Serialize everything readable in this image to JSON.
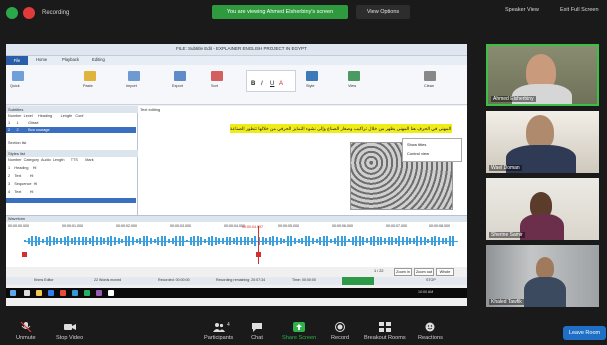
{
  "zoom": {
    "recording_label": "Recording",
    "banner": "You are viewing Ahmed Elsherbiny's screen",
    "view_options": "View Options",
    "speaker_view": "Speaker View",
    "exit_fullscreen": "Exit Full Screen",
    "participants_count": "4",
    "leave": "Leave Room"
  },
  "toolbar": [
    {
      "label": "Unmute",
      "icon": "microphone-muted-icon"
    },
    {
      "label": "Stop Video",
      "icon": "video-camera-icon"
    },
    {
      "label": "Participants",
      "icon": "participants-icon"
    },
    {
      "label": "Chat",
      "icon": "chat-icon"
    },
    {
      "label": "Share Screen",
      "icon": "share-screen-icon"
    },
    {
      "label": "Record",
      "icon": "record-icon"
    },
    {
      "label": "Breakout Rooms",
      "icon": "breakout-rooms-icon"
    },
    {
      "label": "Reactions",
      "icon": "reactions-icon"
    }
  ],
  "gallery": [
    {
      "name": "Ahmed Elsherbiny",
      "active": true
    },
    {
      "name": "Wael Doman",
      "active": false
    },
    {
      "name": "Sherine Samir",
      "active": false
    },
    {
      "name": "Khaled Tawfik",
      "active": false
    }
  ],
  "shared_app": {
    "title": "FILE: Subtitle Edit - EXPLAINER ENGLISH PROJECT IN EGYPT",
    "tabs": [
      "File",
      "Home",
      "Playback",
      "Editing"
    ],
    "ribbon_labels": [
      "Quick",
      "Paste",
      "Import",
      "Export",
      "Sort",
      "Style",
      "View",
      "Clean"
    ],
    "left_pane_title": "Subtitles",
    "left_columns": [
      "Number",
      "Level",
      "Heading",
      "Length",
      "Conf"
    ],
    "left_rows": [
      {
        "num": "1",
        "level": "1",
        "heading": "Glissé"
      },
      {
        "num": "2",
        "level": "2",
        "heading": "Bon courage"
      }
    ],
    "section_label": "Section list",
    "list_pane_title": "Styles list",
    "list_columns": [
      "Number",
      "Category",
      "Audio",
      "Length",
      "TTS",
      "Mark"
    ],
    "list_rows": [
      {
        "num": "1",
        "cat": "Heading",
        "audio": "Hl"
      },
      {
        "num": "2",
        "cat": "Text",
        "audio": "Hl"
      },
      {
        "num": "3",
        "cat": "Sequence",
        "audio": "Hl"
      },
      {
        "num": "4",
        "cat": "Text",
        "audio": "Hl"
      }
    ],
    "editor_tab": "Text editing",
    "arabic_line": "تسيح المتحف تحكى عن المهنى في الحرف هنا المهنى يظهر من خلال تراكيب وصغار الصناع وإلى نشوء التمايز الحرفي من خلالها تتطور الصناعة",
    "view_menu": [
      "Show titles",
      "Control view"
    ],
    "waveform_title": "Waveform",
    "times": [
      "00:00:00.000",
      "00:00:01.000",
      "00:00:02.000",
      "00:00:03.000",
      "00:00:04.000",
      "00:00:05.000",
      "00:00:06.000",
      "00:00:07.000",
      "00:00:08.000"
    ],
    "playhead_time": "00:00:04.597",
    "counter": "1 / 22",
    "zoom_buttons": [
      "Zoom in",
      "Zoom out",
      "Whole"
    ],
    "status": [
      "Khms Editor",
      "22 Words moved",
      "Recorded: 00:00:00",
      "Recording remaining: 20:07:34",
      "Time: 00:00:00",
      "STOP"
    ],
    "taskbar_time": "10:00 AM"
  }
}
